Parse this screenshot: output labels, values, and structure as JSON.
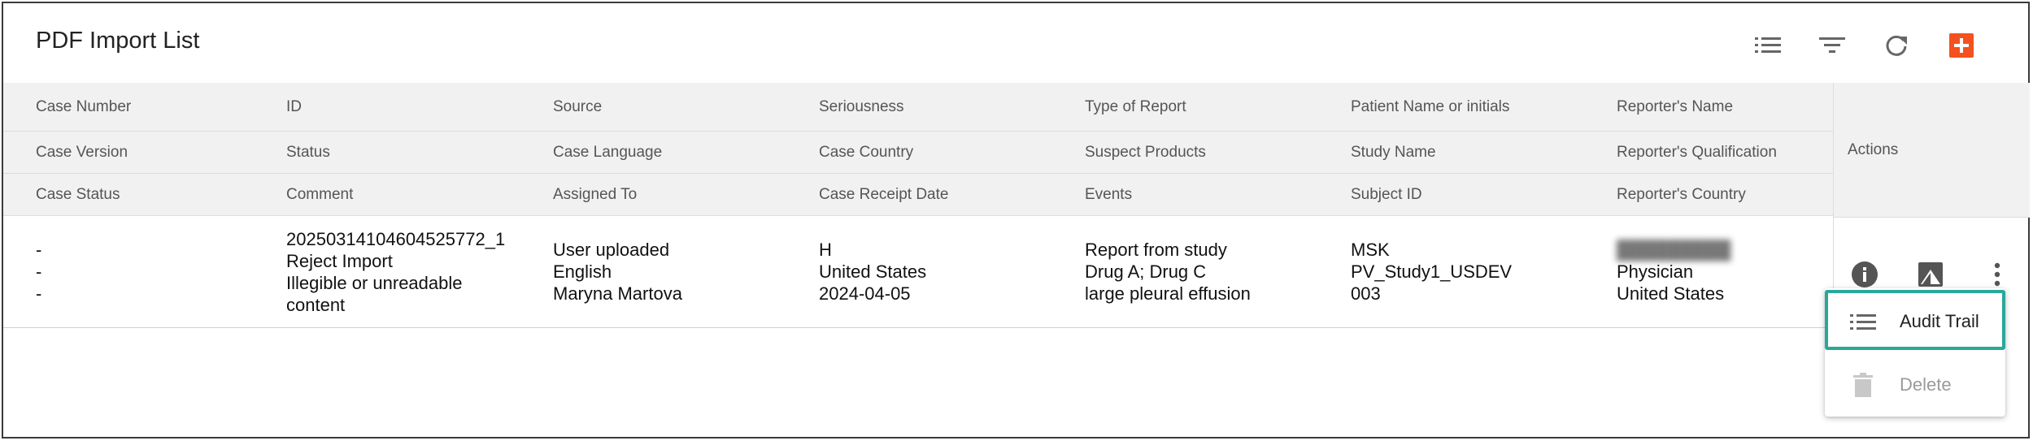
{
  "title": "PDF Import List",
  "toolbar": {
    "icons": [
      "list-icon",
      "filter-icon",
      "refresh-icon",
      "add-icon"
    ],
    "accent_color": "#f4511e"
  },
  "columns": [
    {
      "row1": "Case Number",
      "row2": "Case Version",
      "row3": "Case Status"
    },
    {
      "row1": "ID",
      "row2": "Status",
      "row3": "Comment"
    },
    {
      "row1": "Source",
      "row2": "Case Language",
      "row3": "Assigned To"
    },
    {
      "row1": "Seriousness",
      "row2": "Case Country",
      "row3": "Case Receipt Date"
    },
    {
      "row1": "Type of Report",
      "row2": "Suspect Products",
      "row3": "Events"
    },
    {
      "row1": "Patient Name or initials",
      "row2": "Study Name",
      "row3": "Subject ID"
    },
    {
      "row1": "Reporter's Name",
      "row2": "Reporter's Qualification",
      "row3": "Reporter's Country"
    }
  ],
  "actions_header": "Actions",
  "rows": [
    {
      "cells": [
        [
          "-",
          "-",
          "-"
        ],
        [
          "20250314104604525772_1",
          "Reject Import",
          "Illegible or unreadable",
          "content"
        ],
        [
          "User uploaded",
          "English",
          "Maryna Martova"
        ],
        [
          "H",
          "United States",
          "2024-04-05"
        ],
        [
          "Report from study",
          "Drug A; Drug C",
          "large pleural effusion"
        ],
        [
          "MSK",
          "PV_Study1_USDEV",
          "003"
        ],
        [
          "Physician",
          "United States"
        ]
      ]
    }
  ],
  "row_actions": [
    "info-icon",
    "image-icon",
    "more-vert-icon"
  ],
  "menu": {
    "items": [
      {
        "label": "Audit Trail",
        "icon": "list-icon",
        "enabled": true
      },
      {
        "label": "Delete",
        "icon": "trash-icon",
        "enabled": false
      }
    ],
    "highlight_color": "#2aa79b"
  }
}
